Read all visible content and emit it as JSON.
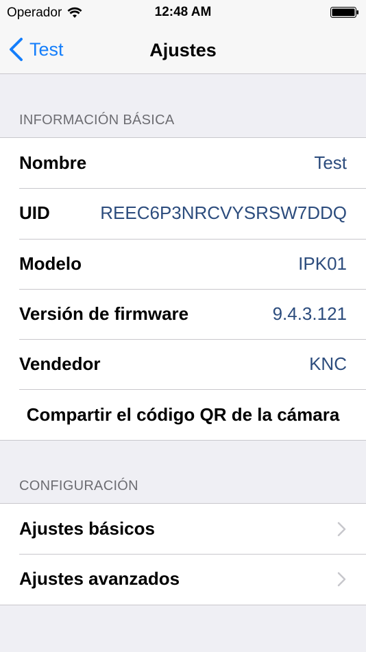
{
  "status_bar": {
    "carrier": "Operador",
    "time": "12:48 AM"
  },
  "nav": {
    "back_label": "Test",
    "title": "Ajustes"
  },
  "basic_info": {
    "header": "INFORMACIÓN BÁSICA",
    "rows": [
      {
        "label": "Nombre",
        "value": "Test"
      },
      {
        "label": "UID",
        "value": "REEC6P3NRCVYSRSW7DDQ"
      },
      {
        "label": "Modelo",
        "value": "IPK01"
      },
      {
        "label": "Versión de firmware",
        "value": "9.4.3.121"
      },
      {
        "label": "Vendedor",
        "value": "KNC"
      }
    ],
    "share_qr_label": "Compartir el código QR de la cámara"
  },
  "configuration": {
    "header": "CONFIGURACIÓN",
    "rows": [
      {
        "label": "Ajustes básicos"
      },
      {
        "label": "Ajustes avanzados"
      }
    ]
  },
  "icons": [
    "wifi-icon",
    "battery-icon",
    "back-chevron-icon",
    "chevron-right-icon"
  ],
  "colors": {
    "accent": "#147efb",
    "value_text": "#2c4c7d",
    "background": "#efeff4"
  }
}
